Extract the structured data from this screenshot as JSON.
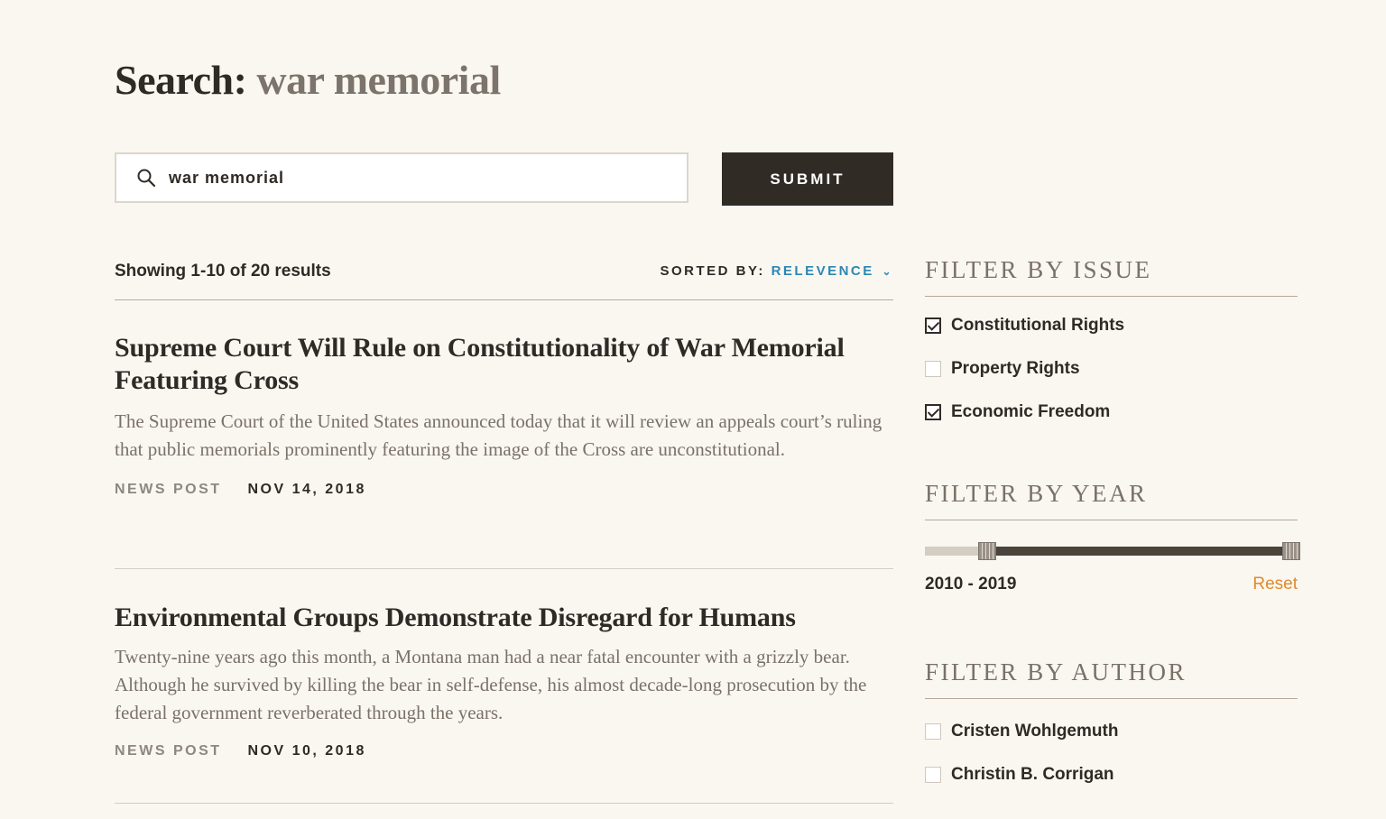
{
  "header": {
    "title_prefix": "Search:",
    "title_query": "war memorial"
  },
  "search": {
    "value": "war memorial",
    "submit_label": "SUBMIT"
  },
  "results_meta": {
    "count_text": "Showing 1-10 of 20 results",
    "sort_label": "SORTED BY:",
    "sort_value": "RELEVENCE"
  },
  "results": [
    {
      "title": "Supreme Court Will Rule on Constitutionality of War Memorial Featuring Cross",
      "excerpt": "The Supreme Court of the United States announced today that it will review an appeals court’s ruling that public memorials prominently featuring the image of the Cross are unconstitutional.",
      "type": "NEWS POST",
      "date": "NOV 14, 2018"
    },
    {
      "title": "Environmental Groups Demonstrate Disregard for Humans",
      "excerpt": "Twenty-nine years ago this month, a Montana man had a near fatal encounter with a grizzly bear. Although he survived by killing the bear in self-defense, his almost decade-long prosecution by the federal government reverberated through the years.",
      "type": "NEWS POST",
      "date": "NOV 10, 2018"
    }
  ],
  "filters": {
    "issue": {
      "heading": "FILTER BY ISSUE",
      "options": [
        {
          "label": "Constitutional Rights",
          "checked": true
        },
        {
          "label": "Property Rights",
          "checked": false
        },
        {
          "label": "Economic Freedom",
          "checked": true
        }
      ]
    },
    "year": {
      "heading": "FILTER BY YEAR",
      "range_text": "2010 - 2019",
      "reset_label": "Reset",
      "selected_start_fraction": 0.15,
      "selected_end_fraction": 1.0
    },
    "author": {
      "heading": "FILTER BY AUTHOR",
      "options": [
        {
          "label": "Cristen Wohlgemuth",
          "checked": false
        },
        {
          "label": "Christin B. Corrigan",
          "checked": false
        }
      ]
    }
  },
  "colors": {
    "background": "#faf7f1",
    "dark": "#312b26",
    "muted": "#7a7168",
    "link_blue": "#2d87b3",
    "reset_orange": "#e08a2c"
  }
}
